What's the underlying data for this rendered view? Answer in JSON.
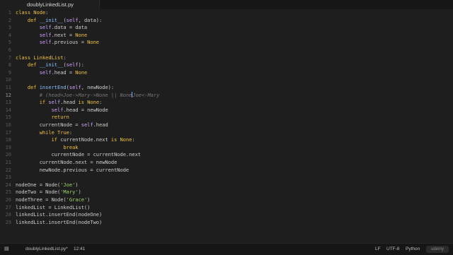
{
  "tab": {
    "title": "doublyLinkedList.py"
  },
  "status": {
    "filename": "doublyLinkedList.py*",
    "cursor_pos": "12:41",
    "line_ending": "LF",
    "encoding": "UTF-8",
    "language": "Python",
    "logo_text": "udemy"
  },
  "editor": {
    "active_line": 12,
    "lines": [
      {
        "n": "1"
      },
      {
        "n": "2"
      },
      {
        "n": "3"
      },
      {
        "n": "4"
      },
      {
        "n": "5"
      },
      {
        "n": "6"
      },
      {
        "n": "7"
      },
      {
        "n": "8"
      },
      {
        "n": "9"
      },
      {
        "n": "10"
      },
      {
        "n": "11"
      },
      {
        "n": "12"
      },
      {
        "n": "13"
      },
      {
        "n": "14"
      },
      {
        "n": "15"
      },
      {
        "n": "16"
      },
      {
        "n": "17"
      },
      {
        "n": "18"
      },
      {
        "n": "19"
      },
      {
        "n": "20"
      },
      {
        "n": "21"
      },
      {
        "n": "22"
      },
      {
        "n": "23"
      },
      {
        "n": "24"
      },
      {
        "n": "25"
      },
      {
        "n": "26"
      },
      {
        "n": "27"
      },
      {
        "n": "28"
      },
      {
        "n": "29"
      }
    ],
    "code": {
      "l1_kw": "class ",
      "l1_name": "Node",
      "l1_rest": ":",
      "l2_kw": "    def ",
      "l2_fn": "__init__",
      "l2_a": "(",
      "l2_self": "self",
      "l2_b": ", data):",
      "l3_ind": "        ",
      "l3_self": "self",
      "l3_rest": ".data = data",
      "l4_ind": "        ",
      "l4_self": "self",
      "l4_rest": ".next = ",
      "l4_const": "None",
      "l5_ind": "        ",
      "l5_self": "self",
      "l5_rest": ".previous = ",
      "l5_const": "None",
      "l7_kw": "class ",
      "l7_name": "LinkedList",
      "l7_rest": ":",
      "l8_kw": "    def ",
      "l8_fn": "__init__",
      "l8_a": "(",
      "l8_self": "self",
      "l8_b": "):",
      "l9_ind": "        ",
      "l9_self": "self",
      "l9_rest": ".head = ",
      "l9_const": "None",
      "l11_kw": "    def ",
      "l11_fn": "insertEnd",
      "l11_a": "(",
      "l11_self": "self",
      "l11_b": ", newNode):",
      "l12_ind": "        ",
      "l12_cmt_a": "# (head=Joe->Mary->None || None",
      "l12_cmt_b": "Joe<-Mary",
      "l13_ind": "        ",
      "l13_kw": "if ",
      "l13_self": "self",
      "l13_rest": ".head ",
      "l13_is": "is ",
      "l13_const": "None",
      "l13_end": ":",
      "l14_ind": "            ",
      "l14_self": "self",
      "l14_rest": ".head = newNode",
      "l15_ind": "            ",
      "l15_kw": "return",
      "l16_ind": "        ",
      "l16_a": "currentNode = ",
      "l16_self": "self",
      "l16_b": ".head",
      "l17_ind": "        ",
      "l17_kw": "while ",
      "l17_const": "True",
      "l17_end": ":",
      "l18_ind": "            ",
      "l18_kw": "if ",
      "l18_a": "currentNode.next ",
      "l18_is": "is ",
      "l18_const": "None",
      "l18_end": ":",
      "l19_ind": "                ",
      "l19_kw": "break",
      "l20_ind": "            ",
      "l20_a": "currentNode = currentNode.next",
      "l21_ind": "        ",
      "l21_a": "currentNode.next = newNode",
      "l22_ind": "        ",
      "l22_a": "newNode.previous = currentNode",
      "l24_a": "nodeOne = Node(",
      "l24_s": "'Joe'",
      "l24_b": ")",
      "l25_a": "nodeTwo = Node(",
      "l25_s": "'Mary'",
      "l25_b": ")",
      "l26_a": "nodeThree = Node(",
      "l26_s": "'Grace'",
      "l26_b": ")",
      "l27_a": "linkedList = LinkedList()",
      "l28_a": "linkedList.insertEnd(nodeOne)",
      "l29_a": "linkedList.insertEnd(nodeTwo)"
    }
  },
  "colors": {
    "keyword": "#f0c14b",
    "function": "#8cc0ff",
    "self": "#d1a2ff",
    "string": "#9dd96e",
    "comment": "#777777",
    "background": "#1e1e1e"
  }
}
